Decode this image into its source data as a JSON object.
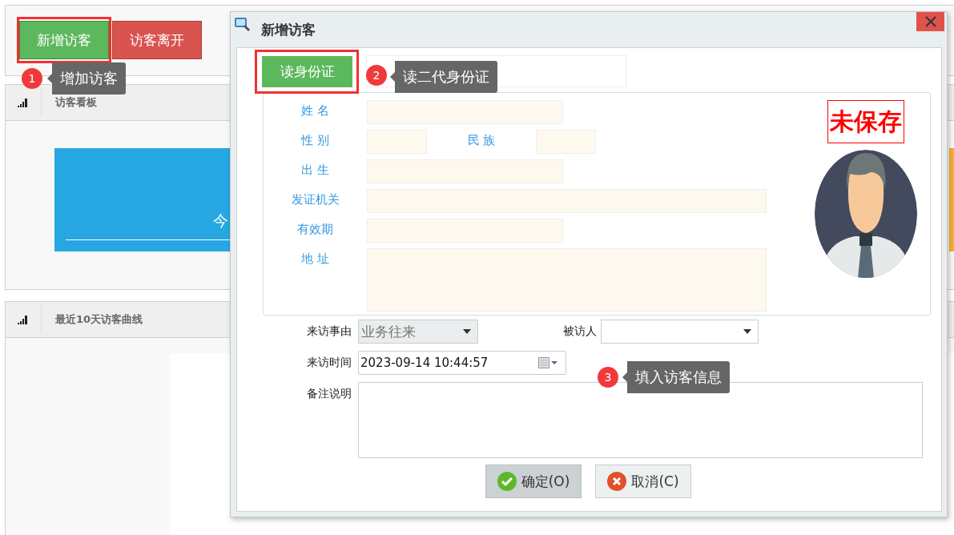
{
  "toolbar": {
    "buttons": [
      {
        "label": "新增访客",
        "kind": "primary"
      },
      {
        "label": "访客离开",
        "kind": "danger"
      }
    ]
  },
  "panels": [
    {
      "title": "访客看板",
      "tile_text": "今"
    },
    {
      "title": "最近10天访客曲线"
    }
  ],
  "dialog": {
    "title": "新增访客",
    "read_id_button": "读身份证",
    "id_rows": [
      {
        "fields": [
          {
            "label": "姓 名",
            "kind": "medium"
          }
        ]
      },
      {
        "fields": [
          {
            "label": "性 别",
            "kind": "small"
          },
          {
            "label": "民 族",
            "kind": "small"
          }
        ]
      },
      {
        "fields": [
          {
            "label": "出 生",
            "kind": "medium"
          }
        ]
      },
      {
        "fields": [
          {
            "label": "发证机关",
            "kind": "wide"
          }
        ]
      },
      {
        "fields": [
          {
            "label": "有效期",
            "kind": "medium"
          }
        ]
      },
      {
        "fields": [
          {
            "label": "地 址",
            "kind": "area"
          }
        ]
      }
    ],
    "status": "未保存",
    "reason": {
      "label": "来访事由",
      "value": "业务往来",
      "disabled": true
    },
    "host": {
      "label": "被访人"
    },
    "time": {
      "label": "来访时间",
      "value": "2023-09-14 10:44:57"
    },
    "remark": {
      "label": "备注说明"
    },
    "buttons": [
      {
        "label": "确定(O)",
        "kind": "ok",
        "focused": true
      },
      {
        "label": "取消(C)",
        "kind": "cancel",
        "focused": false
      }
    ]
  },
  "annotations": [
    {
      "number": "1",
      "text": "增加访客",
      "framed": true
    },
    {
      "number": "2",
      "text": "读二代身份证",
      "framed": true
    },
    {
      "number": "3",
      "text": "填入访客信息",
      "framed": false
    }
  ]
}
